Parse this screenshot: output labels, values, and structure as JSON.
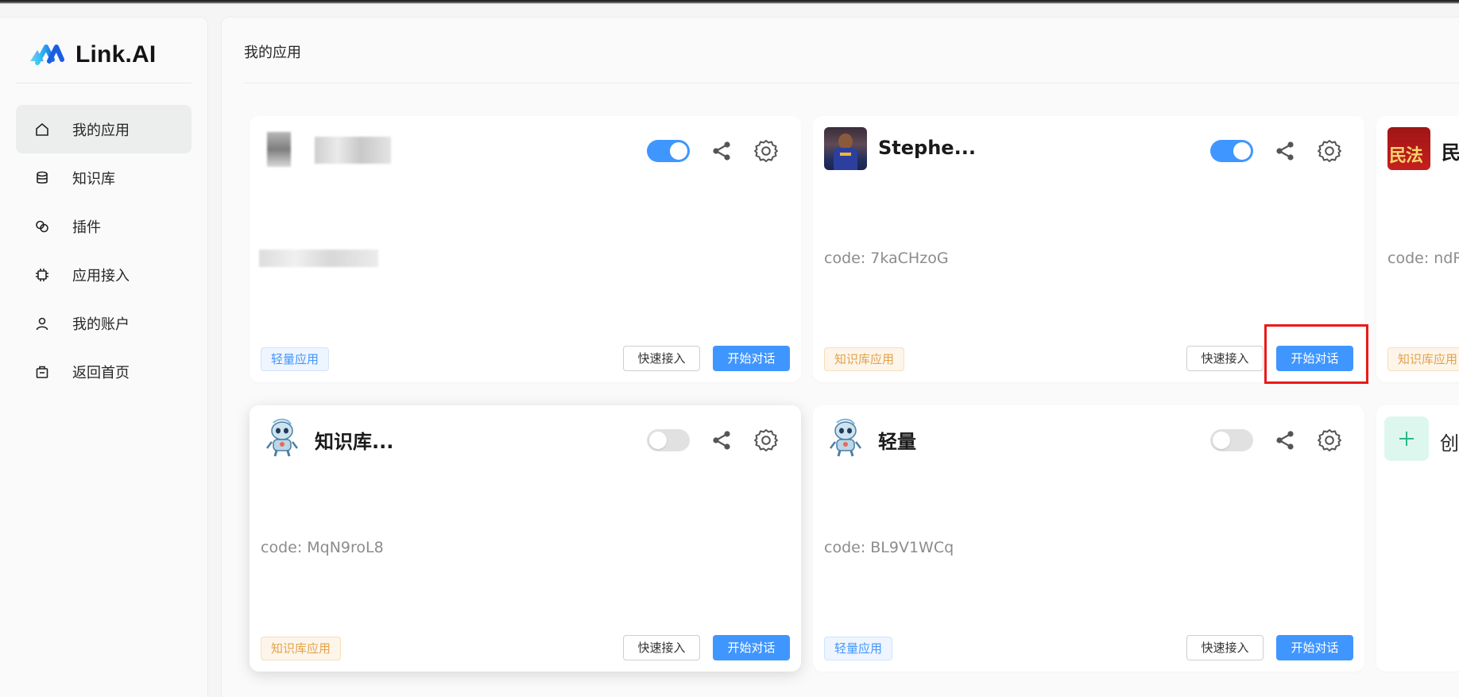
{
  "brand": {
    "name": "Link.AI"
  },
  "sidebar": {
    "items": [
      {
        "label": "我的应用",
        "icon": "home-icon",
        "active": true
      },
      {
        "label": "知识库",
        "icon": "database-icon",
        "active": false
      },
      {
        "label": "插件",
        "icon": "link-icon",
        "active": false
      },
      {
        "label": "应用接入",
        "icon": "chip-icon",
        "active": false
      },
      {
        "label": "我的账户",
        "icon": "user-icon",
        "active": false
      },
      {
        "label": "返回首页",
        "icon": "bag-icon",
        "active": false
      }
    ]
  },
  "main": {
    "title": "我的应用",
    "cards": [
      {
        "name": "",
        "code": "",
        "enabled": true,
        "tag": "轻量应用",
        "tag_color": "blue",
        "quick_label": "快速接入",
        "chat_label": "开始对话",
        "avatar": "blurred-avatar"
      },
      {
        "name": "Stephe...",
        "code": "code: 7kaCHzoG",
        "enabled": true,
        "tag": "知识库应用",
        "tag_color": "orange",
        "quick_label": "快速接入",
        "chat_label": "开始对话",
        "avatar": "player-photo"
      },
      {
        "name": "民",
        "code": "code: ndR",
        "tag": "知识库应用",
        "tag_color": "orange",
        "avatar": "civil-law-cover",
        "avatar_text": "民法"
      },
      {
        "name": "知识库...",
        "code": "code: MqN9roL8",
        "enabled": false,
        "tag": "知识库应用",
        "tag_color": "orange",
        "quick_label": "快速接入",
        "chat_label": "开始对话",
        "avatar": "robot-avatar"
      },
      {
        "name": "轻量",
        "code": "code: BL9V1WCq",
        "enabled": false,
        "tag": "轻量应用",
        "tag_color": "blue",
        "quick_label": "快速接入",
        "chat_label": "开始对话",
        "avatar": "robot-avatar"
      }
    ],
    "create": {
      "label": "创",
      "icon": "plus-icon"
    }
  },
  "colors": {
    "accent": "#4096ff",
    "highlight": "#ea1a1a",
    "tag_orange": "#e3a24a"
  }
}
